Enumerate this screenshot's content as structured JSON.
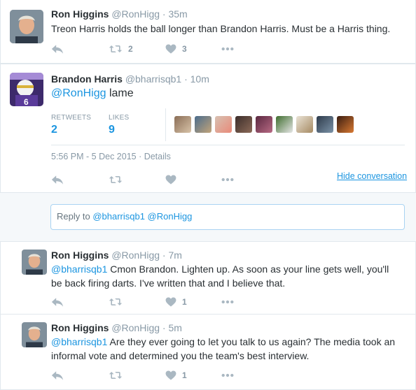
{
  "tweet1": {
    "name": "Ron Higgins",
    "handle": "@RonHigg",
    "time": "· 35m",
    "text": "Treon Harris holds the ball longer than Brandon Harris. Must be a Harris thing.",
    "retweets": "2",
    "likes": "3"
  },
  "main": {
    "name": "Brandon Harris",
    "handle": "@bharrisqb1",
    "time": "· 10m",
    "mention": "@RonHigg",
    "text": " lame",
    "retweets_label": "RETWEETS",
    "retweets": "2",
    "likes_label": "LIKES",
    "likes": "9",
    "datetime": "5:56 PM - 5 Dec 2015 · Details",
    "hide_conversation": "Hide conversation"
  },
  "reply_box": {
    "prefix": "Reply to ",
    "mentions": "@bharrisqb1 @RonHigg"
  },
  "replies": [
    {
      "name": "Ron Higgins",
      "handle": "@RonHigg",
      "time": "· 7m",
      "mention": "@bharrisqb1",
      "line1": " Cmon Brandon. Lighten up.  As soon as your line gets well, you'll",
      "line2": "be back firing darts. I've written that and I believe that.",
      "likes": "1"
    },
    {
      "name": "Ron Higgins",
      "handle": "@RonHigg",
      "time": "· 5m",
      "mention": "@bharrisqb1",
      "line1": " Are they ever going to let you talk to us again? The media took an",
      "line2": "informal vote and determined you the team's best interview.",
      "likes": "1"
    }
  ],
  "icons": [
    "reply-icon",
    "retweet-icon",
    "heart-icon",
    "more-icon"
  ],
  "colors": {
    "link": "#1b95e0",
    "muted": "#8899a6",
    "icon": "#aab8c2",
    "border": "#e1e8ed"
  }
}
